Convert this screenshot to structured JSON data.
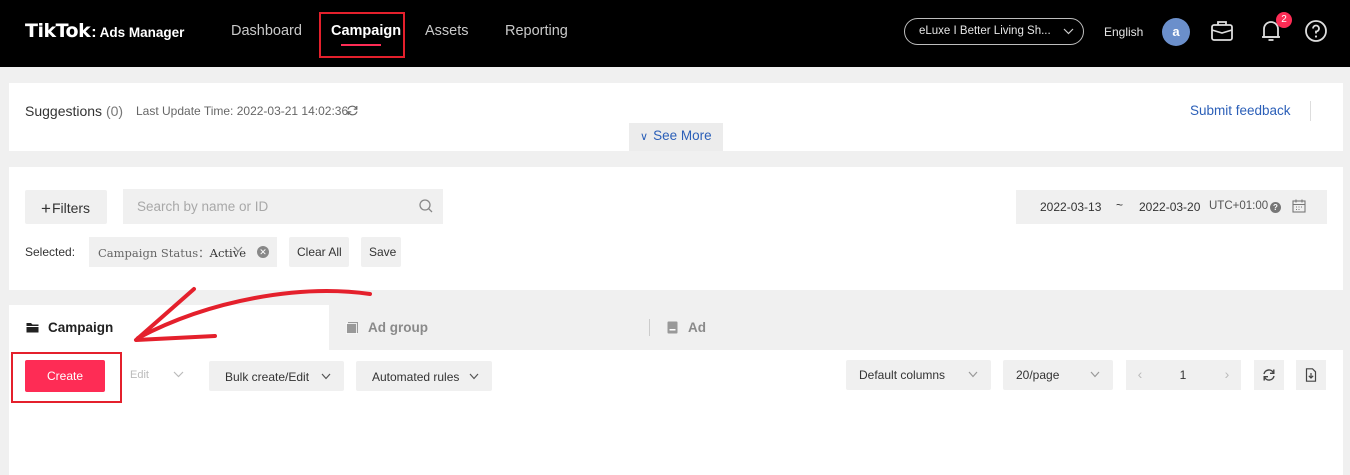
{
  "header": {
    "logo_main": "TikTok",
    "logo_colon": ":",
    "logo_sub": "Ads Manager",
    "nav": [
      "Dashboard",
      "Campaign",
      "Assets",
      "Reporting"
    ],
    "account": "eLuxe I Better Living Sh...",
    "language": "English",
    "avatar_letter": "a",
    "notification_count": "2"
  },
  "suggestions": {
    "title": "Suggestions",
    "count": "(0)",
    "last_update": "Last Update Time: 2022-03-21 14:02:36",
    "see_more": "See More",
    "submit_feedback": "Submit feedback"
  },
  "filters": {
    "filters_label": "Filters",
    "search_placeholder": "Search by name or ID",
    "date_start": "2022-03-13",
    "date_sep": "~",
    "date_end": "2022-03-20",
    "timezone": "UTC+01:00",
    "selected_label": "Selected:",
    "chip_key": "Campaign Status：",
    "chip_value": "Active",
    "clear_all": "Clear All",
    "save": "Save"
  },
  "tabs": [
    "Campaign",
    "Ad group",
    "Ad"
  ],
  "toolbar": {
    "create": "Create",
    "edit": "Edit",
    "bulk": "Bulk create/Edit",
    "automated": "Automated rules",
    "columns": "Default columns",
    "per_page": "20/page",
    "page": "1"
  },
  "colors": {
    "accent": "#fe2c55",
    "link": "#2b5fb8",
    "annotation": "#e4202c"
  }
}
